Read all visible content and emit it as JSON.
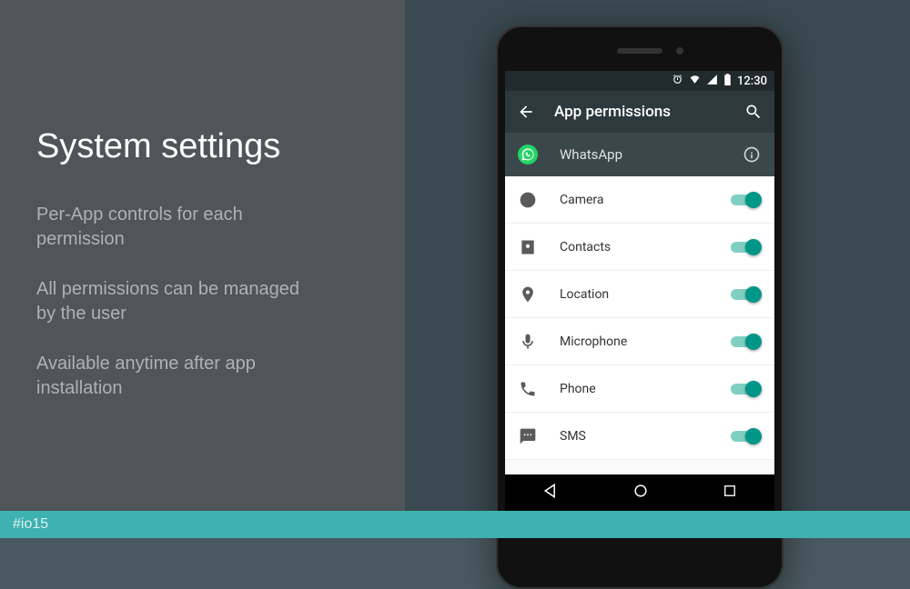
{
  "slide": {
    "title": "System settings",
    "bullets": [
      "Per-App controls for each permission",
      "All permissions can be managed by the user",
      "Available anytime after app installation"
    ],
    "hashtag": "#io15"
  },
  "phone": {
    "statusbar": {
      "time": "12:30"
    },
    "appbar": {
      "title": "App permissions"
    },
    "subheader": {
      "appname": "WhatsApp"
    },
    "permissions": [
      {
        "icon": "camera",
        "label": "Camera",
        "enabled": true
      },
      {
        "icon": "contacts",
        "label": "Contacts",
        "enabled": true
      },
      {
        "icon": "location",
        "label": "Location",
        "enabled": true
      },
      {
        "icon": "microphone",
        "label": "Microphone",
        "enabled": true
      },
      {
        "icon": "phone",
        "label": "Phone",
        "enabled": true
      },
      {
        "icon": "sms",
        "label": "SMS",
        "enabled": true
      }
    ]
  },
  "colors": {
    "accent_teal": "#009688",
    "footer_teal": "#3eb2b0",
    "whatsapp_green": "#25d366"
  }
}
